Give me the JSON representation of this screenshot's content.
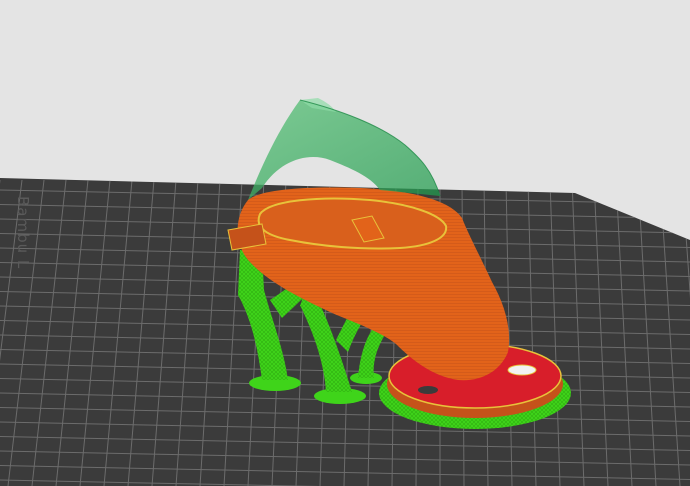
{
  "viewport": {
    "bed_brand_label": "Bambu L"
  },
  "colors": {
    "background": "#e4e4e4",
    "bed_plate": "#3b3b3b",
    "bed_grid": "#6c6c6c",
    "model_orange": "#e2631a",
    "model_orange_dark": "#c5521a",
    "overhang_red": "#d81e2a",
    "support_green": "#3fd41a",
    "preview_green": "#2aa85a",
    "perimeter_yellow": "#e8c23a"
  },
  "icons": {
    "model": "sliced-part-preview",
    "supports": "tree-support-structure"
  }
}
